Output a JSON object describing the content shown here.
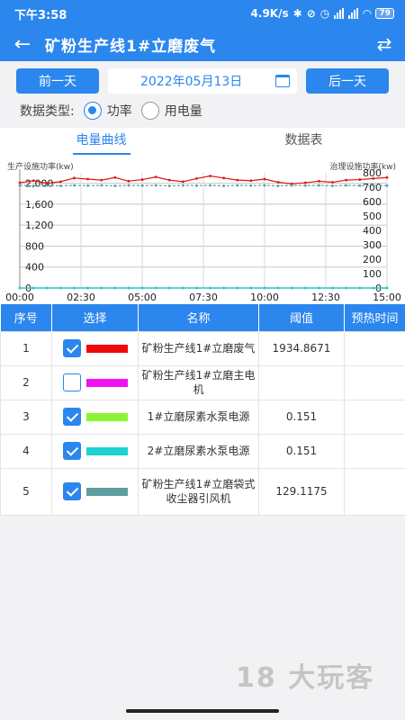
{
  "status": {
    "time": "下午3:58",
    "net_speed": "4.9K/s",
    "battery": "79"
  },
  "header": {
    "title": "矿粉生产线1#立磨废气",
    "back_icon": "back-arrow-icon",
    "swap_icon": "swap-icon"
  },
  "date_bar": {
    "prev_label": "前一天",
    "date": "2022年05月13日",
    "next_label": "后一天"
  },
  "type_bar": {
    "label": "数据类型:",
    "options": [
      {
        "label": "功率",
        "selected": true
      },
      {
        "label": "用电量",
        "selected": false
      }
    ]
  },
  "tabs": [
    {
      "label": "电量曲线",
      "active": true
    },
    {
      "label": "数据表",
      "active": false
    }
  ],
  "chart_data": {
    "type": "line",
    "left_axis_label": "生产设施功率(kw)",
    "right_axis_label": "治理设施功率(kw)",
    "left_ticks": [
      "0",
      "400",
      "800",
      "1,200",
      "1,600",
      "2,000"
    ],
    "left_ylim": [
      0,
      2200
    ],
    "right_ticks": [
      "0",
      "100",
      "200",
      "300",
      "400",
      "500",
      "600",
      "700",
      "800"
    ],
    "right_ylim": [
      0,
      800
    ],
    "x_ticks": [
      "00:00",
      "02:30",
      "05:00",
      "07:30",
      "10:00",
      "12:30",
      "15:00"
    ],
    "series": [
      {
        "color": "#e01515",
        "values": [
          2010,
          2050,
          2000,
          2030,
          2100,
          2080,
          2060,
          2110,
          2040,
          2070,
          2120,
          2060,
          2030,
          2090,
          2140,
          2100,
          2060,
          2050,
          2080,
          2020,
          1990,
          2010,
          2040,
          2020,
          2060,
          2070,
          2090,
          2110
        ]
      },
      {
        "color": "#f010f0",
        "values": [
          0,
          0,
          0,
          0,
          0,
          0,
          0,
          0,
          0,
          0,
          0,
          0,
          0,
          0,
          0,
          0,
          0,
          0,
          0,
          0,
          0,
          0,
          0,
          0,
          0,
          0,
          0,
          0
        ]
      },
      {
        "color": "#8cf531",
        "values": [
          0,
          0,
          0,
          0,
          0,
          0,
          0,
          0,
          0,
          0,
          0,
          0,
          0,
          0,
          0,
          0,
          0,
          0,
          0,
          0,
          0,
          0,
          0,
          0,
          0,
          0,
          0,
          0
        ]
      },
      {
        "color": "#1fd1d1",
        "values": [
          0,
          0,
          0,
          0,
          0,
          0,
          0,
          0,
          0,
          0,
          0,
          0,
          0,
          0,
          0,
          0,
          0,
          0,
          0,
          0,
          0,
          0,
          0,
          0,
          0,
          0,
          0,
          0
        ]
      },
      {
        "color": "#5f9ea0",
        "values": [
          1960,
          1950,
          1960,
          1950,
          1960,
          1955,
          1960,
          1950,
          1960,
          1955,
          1960,
          1950,
          1960,
          1955,
          1960,
          1950,
          1960,
          1955,
          1960,
          1950,
          1960,
          1955,
          1960,
          1950,
          1960,
          1955,
          1960,
          1955
        ]
      }
    ]
  },
  "table": {
    "headers": [
      "序号",
      "选择",
      "名称",
      "阈值",
      "预热时间"
    ],
    "rows": [
      {
        "index": "1",
        "checked": true,
        "color": "#ee0a0a",
        "name": "矿粉生产线1#立磨废气",
        "threshold": "1934.8671"
      },
      {
        "index": "2",
        "checked": false,
        "color": "#f010f0",
        "name": "矿粉生产线1#立磨主电机",
        "threshold": ""
      },
      {
        "index": "3",
        "checked": true,
        "color": "#8cf531",
        "name": "1#立磨尿素水泵电源",
        "threshold": "0.151"
      },
      {
        "index": "4",
        "checked": true,
        "color": "#1fd1d1",
        "name": "2#立磨尿素水泵电源",
        "threshold": "0.151"
      },
      {
        "index": "5",
        "checked": true,
        "color": "#5f9ea0",
        "name": "矿粉生产线1#立磨袋式收尘器引风机",
        "threshold": "129.1175"
      }
    ]
  },
  "watermark": "18 大玩客"
}
